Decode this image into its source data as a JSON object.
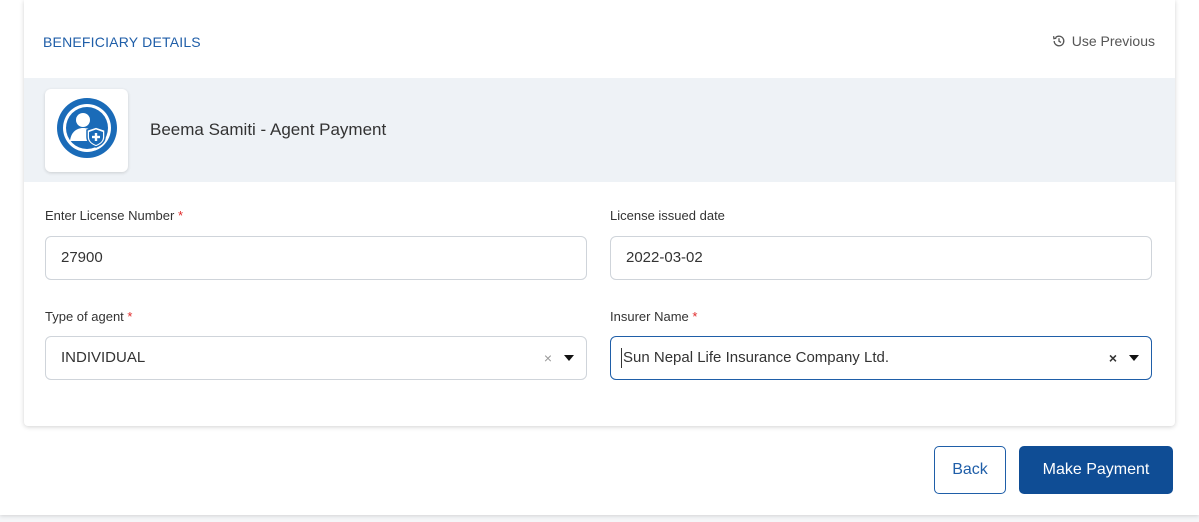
{
  "card": {
    "title": "BENEFICIARY DETAILS",
    "use_previous": "Use Previous"
  },
  "service": {
    "name": "Beema Samiti - Agent Payment",
    "logo_icon": "insurance-agent-shield-icon"
  },
  "form": {
    "license_number": {
      "label": "Enter License Number",
      "required_mark": "*",
      "value": "27900"
    },
    "license_date": {
      "label": "License issued date",
      "value": "2022-03-02"
    },
    "agent_type": {
      "label": "Type of agent",
      "required_mark": "*",
      "value": "INDIVIDUAL",
      "clear": "×"
    },
    "insurer_name": {
      "label": "Insurer Name",
      "required_mark": "*",
      "value": "Sun Nepal Life Insurance Company Ltd.",
      "clear": "×"
    }
  },
  "actions": {
    "back_label": "Back",
    "pay_label": "Make Payment"
  },
  "colors": {
    "accent": "#1f5ea8",
    "primary_button": "#0f4d95",
    "required": "#e02b2b",
    "band": "#eef2f6"
  }
}
